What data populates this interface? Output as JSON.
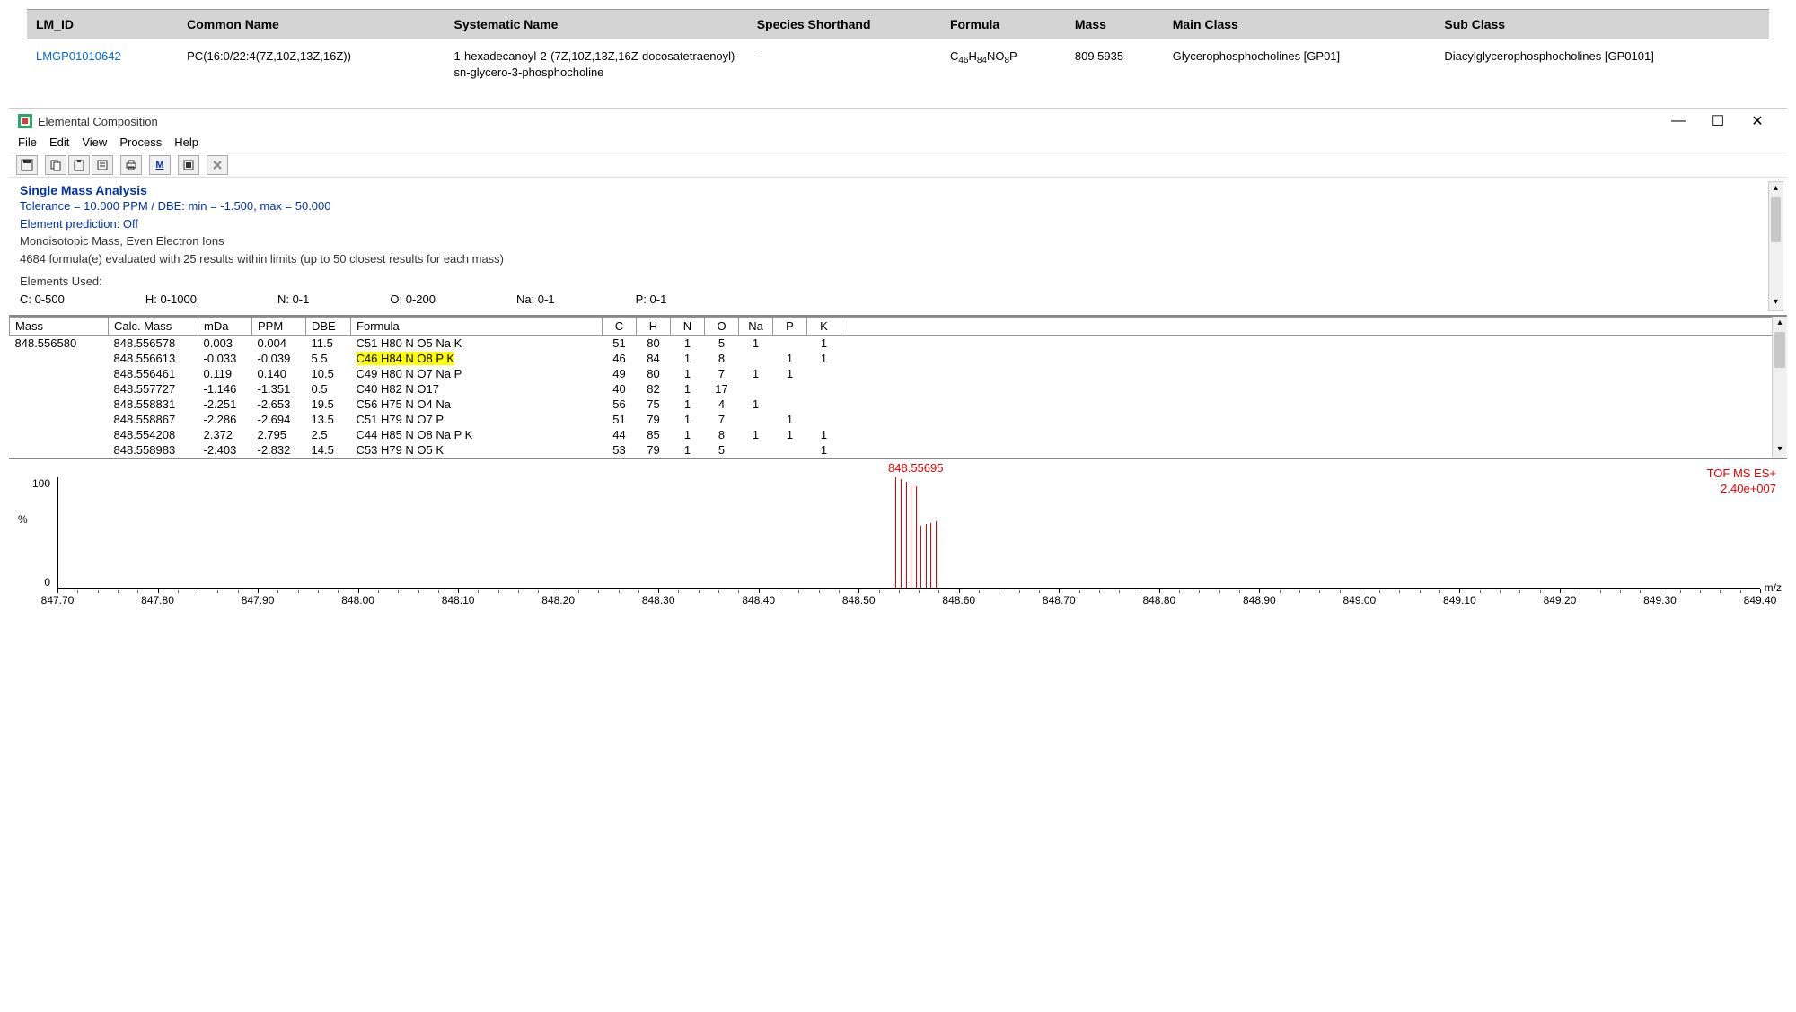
{
  "lipid_table": {
    "headers": [
      "LM_ID",
      "Common Name",
      "Systematic Name",
      "Species Shorthand",
      "Formula",
      "Mass",
      "Main Class",
      "Sub Class"
    ],
    "row": {
      "lm_id": "LMGP01010642",
      "common_name": "PC(16:0/22:4(7Z,10Z,13Z,16Z))",
      "systematic_name": "1-hexadecanoyl-2-(7Z,10Z,13Z,16Z-docosatetraenoyl)-sn-glycero-3-phosphocholine",
      "species_shorthand": "-",
      "formula_html": "C₄₆H₈₄NO₈P",
      "mass": "809.5935",
      "main_class": "Glycerophosphocholines [GP01]",
      "sub_class": "Diacylglycerophosphocholines [GP0101]"
    }
  },
  "window": {
    "title": "Elemental Composition",
    "controls": {
      "min": "—",
      "max": "☐",
      "close": "✕"
    }
  },
  "menu": [
    "File",
    "Edit",
    "View",
    "Process",
    "Help"
  ],
  "toolbar_icons": [
    "save-icon",
    "copy-icon",
    "paste-icon",
    "properties-icon",
    "print-icon",
    "m-icon",
    "fit-icon",
    "cancel-icon"
  ],
  "analysis": {
    "title": "Single Mass Analysis",
    "tolerance_line": "Tolerance = 10.000 PPM   /   DBE: min = -1.500, max = 50.000",
    "element_pred": "Element prediction: Off",
    "mono": "Monoisotopic Mass, Even Electron Ions",
    "eval_line": "4684 formula(e) evaluated with 25 results within limits (up to 50 closest results for each mass)",
    "elements_used": "Elements Used:",
    "ranges": [
      "C: 0-500",
      "H: 0-1000",
      "N: 0-1",
      "O: 0-200",
      "Na: 0-1",
      "P: 0-1"
    ]
  },
  "results": {
    "headers": [
      "Mass",
      "Calc. Mass",
      "mDa",
      "PPM",
      "DBE",
      "Formula",
      "C",
      "H",
      "N",
      "O",
      "Na",
      "P",
      "K"
    ],
    "input_mass": "848.556580",
    "rows": [
      {
        "calc": "848.556578",
        "mda": "0.003",
        "ppm": "0.004",
        "dbe": "11.5",
        "formula": "C51 H80 N O5 Na K",
        "c": "51",
        "h": "80",
        "n": "1",
        "o": "5",
        "na": "1",
        "p": "",
        "k": "1",
        "hl": false
      },
      {
        "calc": "848.556613",
        "mda": "-0.033",
        "ppm": "-0.039",
        "dbe": "5.5",
        "formula": "C46 H84 N O8 P K",
        "c": "46",
        "h": "84",
        "n": "1",
        "o": "8",
        "na": "",
        "p": "1",
        "k": "1",
        "hl": true
      },
      {
        "calc": "848.556461",
        "mda": "0.119",
        "ppm": "0.140",
        "dbe": "10.5",
        "formula": "C49 H80 N O7 Na P",
        "c": "49",
        "h": "80",
        "n": "1",
        "o": "7",
        "na": "1",
        "p": "1",
        "k": "",
        "hl": false
      },
      {
        "calc": "848.557727",
        "mda": "-1.146",
        "ppm": "-1.351",
        "dbe": "0.5",
        "formula": "C40 H82 N O17",
        "c": "40",
        "h": "82",
        "n": "1",
        "o": "17",
        "na": "",
        "p": "",
        "k": "",
        "hl": false
      },
      {
        "calc": "848.558831",
        "mda": "-2.251",
        "ppm": "-2.653",
        "dbe": "19.5",
        "formula": "C56 H75 N O4 Na",
        "c": "56",
        "h": "75",
        "n": "1",
        "o": "4",
        "na": "1",
        "p": "",
        "k": "",
        "hl": false
      },
      {
        "calc": "848.558867",
        "mda": "-2.286",
        "ppm": "-2.694",
        "dbe": "13.5",
        "formula": "C51 H79 N O7 P",
        "c": "51",
        "h": "79",
        "n": "1",
        "o": "7",
        "na": "",
        "p": "1",
        "k": "",
        "hl": false
      },
      {
        "calc": "848.554208",
        "mda": "2.372",
        "ppm": "2.795",
        "dbe": "2.5",
        "formula": "C44 H85 N O8 Na P K",
        "c": "44",
        "h": "85",
        "n": "1",
        "o": "8",
        "na": "1",
        "p": "1",
        "k": "1",
        "hl": false
      },
      {
        "calc": "848.558983",
        "mda": "-2.403",
        "ppm": "-2.832",
        "dbe": "14.5",
        "formula": "C53 H79 N O5 K",
        "c": "53",
        "h": "79",
        "n": "1",
        "o": "5",
        "na": "",
        "p": "",
        "k": "1",
        "hl": false
      }
    ]
  },
  "chart_data": {
    "type": "line",
    "title": "",
    "xlabel": "m/z",
    "ylabel": "%",
    "ylim": [
      0,
      100
    ],
    "xlim": [
      847.7,
      849.4
    ],
    "xticks": [
      847.7,
      847.8,
      847.9,
      848.0,
      848.1,
      848.2,
      848.3,
      848.4,
      848.5,
      848.6,
      848.7,
      848.8,
      848.9,
      849.0,
      849.1,
      849.2,
      849.3,
      849.4
    ],
    "peak": {
      "mz": 848.55695,
      "label": "848.55695",
      "intensity": 100
    },
    "annotation_right": [
      "TOF MS ES+",
      "2.40e+007"
    ],
    "y_ticks": [
      "100",
      "0"
    ]
  }
}
